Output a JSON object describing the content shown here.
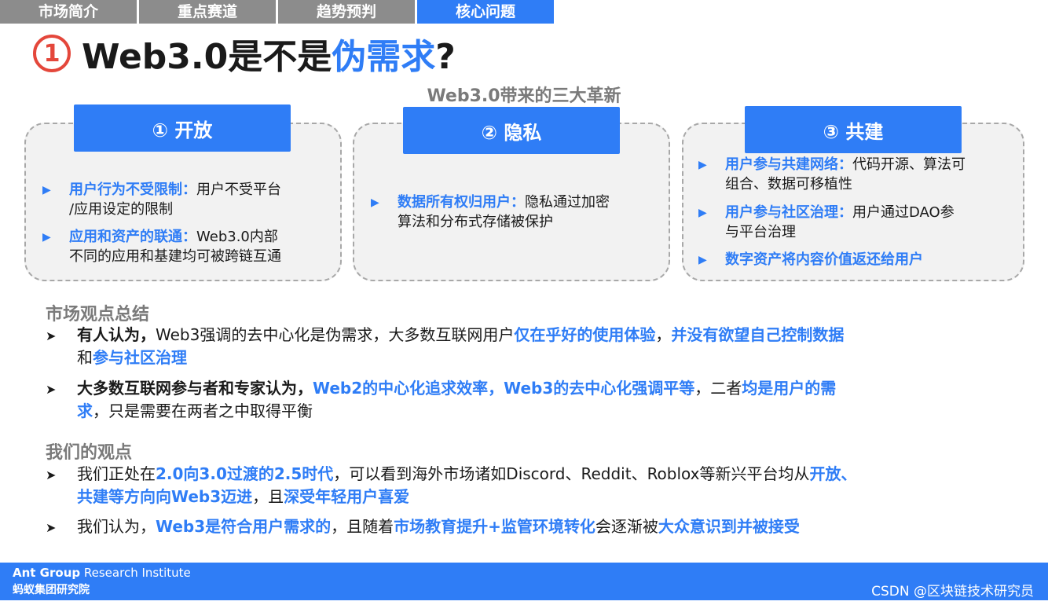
{
  "tabs": [
    "市场简介",
    "重点赛道",
    "趋势预判",
    "核心问题"
  ],
  "title": {
    "num": "①",
    "pre": "Web3.0是不是",
    "hl": "伪需求",
    "post": "?"
  },
  "subtitle": "Web3.0带来的三大革新",
  "cards": [
    {
      "head": "① 开放",
      "items": [
        {
          "b": "用户行为不受限制：",
          "t1": "用户不受平台",
          "t2": "/应用设定的限制"
        },
        {
          "b": "应用和资产的联通：",
          "t1": "Web3.0内部",
          "t2": "不同的应用和基建均可被跨链互通"
        }
      ]
    },
    {
      "head": "② 隐私",
      "items": [
        {
          "b": "数据所有权归用户：",
          "t1": "隐私通过加密",
          "t2": "算法和分布式存储被保护"
        }
      ]
    },
    {
      "head": "③ 共建",
      "items": [
        {
          "b": "用户参与共建网络：",
          "t1": "代码开源、算法可",
          "t2": "组合、数据可移植性"
        },
        {
          "b": "用户参与社区治理：",
          "t1": "用户通过DAO参",
          "t2": "与平台治理"
        },
        {
          "b": "数字资产将内容价值返还给用户",
          "t1": "",
          "t2": ""
        }
      ]
    }
  ],
  "summary": {
    "heading": "市场观点总结",
    "p1": {
      "bk": "有人认为，",
      "t1": "Web3强调的去中心化是伪需求，大多数互联网用户",
      "bl1": "仅在乎好的使用体验",
      "t2": "，",
      "bl2": "并没有欲望自己控制数据",
      "t3": "和",
      "bl3": "参与社区治理"
    },
    "p2": {
      "bk": "大多数互联网参与者和专家认为，",
      "bl1": "Web2的中心化追求效率，Web3的去中心化强调平等",
      "t1": "，二者",
      "bl2": "均是用户的需",
      "bl3": "求",
      "t2": "，只是需要在两者之中取得平衡"
    }
  },
  "ours": {
    "heading": "我们的观点",
    "p1": {
      "t1": "我们正处在",
      "bl1": "2.0向3.0过渡的2.5时代",
      "t2": "，可以看到海外市场诸如Discord、Reddit、Roblox等新兴平台均从",
      "bl2": "开放、",
      "bl3": "共建等方向向Web3迈进",
      "t3": "，且",
      "bl4": "深受年轻用户喜爱"
    },
    "p2": {
      "t1": "我们认为，",
      "bl1": "Web3是符合用户需求的",
      "t2": "，且随着",
      "bl2": "市场教育提升+监管环境转化",
      "t3": "会逐渐被",
      "bl3": "大众意识到并被接受"
    }
  },
  "footer": {
    "org_en_bold": "Ant Group",
    "org_en_rest": " Research Institute",
    "org_cn": "蚂蚁集团研究院"
  },
  "watermark": "CSDN @区块链技术研究员"
}
